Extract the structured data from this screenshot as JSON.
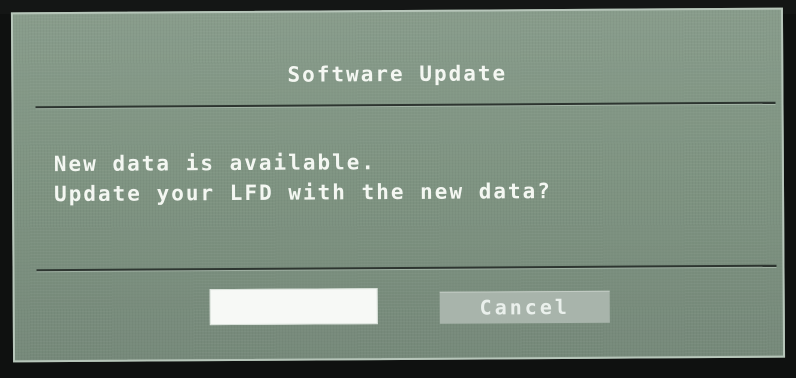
{
  "dialog": {
    "title": "Software Update",
    "message_line1": "New data is available.",
    "message_line2": "Update your LFD with the new data?",
    "ok_label": "",
    "cancel_label": "Cancel"
  },
  "colors": {
    "dialog_background": "#7f9382",
    "dialog_border": "#b7c6ba",
    "text": "#f4f7f2",
    "selected_button": "#f7f9f6",
    "cancel_button": "#a8b4ab"
  }
}
